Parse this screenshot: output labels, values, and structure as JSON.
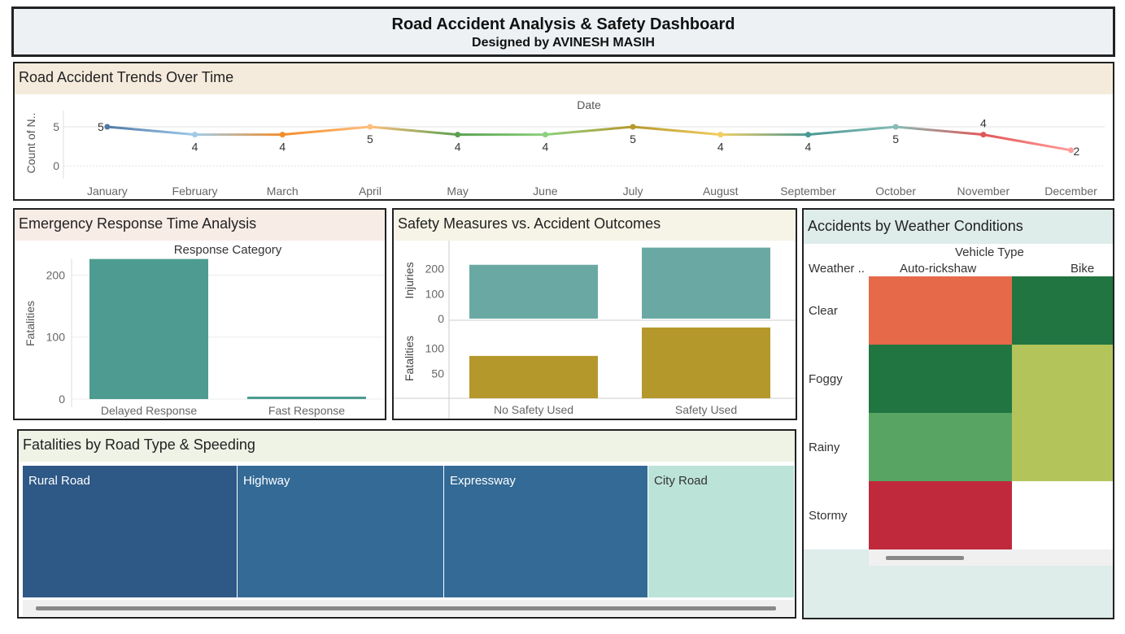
{
  "header": {
    "title": "Road Accident Analysis & Safety Dashboard",
    "subtitle": "Designed by AVINESH MASIH"
  },
  "colors": {
    "teal": "#4e9c91",
    "teal_light": "#6aa9a3",
    "olive": "#b5982c",
    "treemap_dark": "#2e5886",
    "treemap_mid": "#336a96",
    "treemap_light": "#bce3d8",
    "hm_orange": "#e6694a",
    "hm_dark_green": "#217540",
    "hm_mid_green": "#58a563",
    "hm_yellow_green": "#b2c45a",
    "hm_red": "#c0293c"
  },
  "trends": {
    "panel_title": "Road Accident Trends Over Time",
    "chart_data": {
      "type": "line",
      "title": "Date",
      "xlabel": "Date",
      "ylabel": "Count of N..",
      "ylim": [
        0,
        6
      ],
      "y_ticks": [
        0,
        5
      ],
      "categories": [
        "January",
        "February",
        "March",
        "April",
        "May",
        "June",
        "July",
        "August",
        "September",
        "October",
        "November",
        "December"
      ],
      "values": [
        5,
        4,
        4,
        5,
        4,
        4,
        5,
        4,
        4,
        5,
        4,
        2
      ],
      "point_colors": [
        "#4e79a7",
        "#a0cbe8",
        "#f28e2b",
        "#ffbe7d",
        "#59a14f",
        "#8cd17d",
        "#b6992d",
        "#f1ce63",
        "#499894",
        "#86bcb6",
        "#e15759",
        "#ff9d9a"
      ]
    }
  },
  "response": {
    "panel_title": "Emergency Response Time Analysis",
    "chart_data": {
      "type": "bar",
      "title": "Response Category",
      "ylabel": "Fatalities",
      "categories": [
        "Delayed Response",
        "Fast Response"
      ],
      "values": [
        226,
        4
      ],
      "ylim": [
        0,
        236
      ],
      "y_ticks": [
        0,
        100,
        200
      ]
    }
  },
  "safety": {
    "panel_title": "Safety Measures vs. Accident Outcomes",
    "chart_data": {
      "type": "bar",
      "categories": [
        "No Safety Used",
        "Safety Used"
      ],
      "series": [
        {
          "name": "Injuries",
          "values": [
            216,
            285
          ],
          "ylim": [
            0,
            300
          ],
          "y_ticks": [
            0,
            100,
            200
          ]
        },
        {
          "name": "Fatalities",
          "values": [
            85,
            142
          ],
          "ylim": [
            0,
            150
          ],
          "y_ticks": [
            50,
            100
          ]
        }
      ]
    }
  },
  "treemap": {
    "panel_title": "Fatalities by Road Type & Speeding",
    "items": [
      {
        "label": "Rural Road"
      },
      {
        "label": "Highway"
      },
      {
        "label": "Expressway"
      },
      {
        "label": "City Road"
      }
    ]
  },
  "weather": {
    "panel_title": "Accidents by Weather Conditions",
    "chart_data": {
      "type": "heatmap",
      "column_header": "Vehicle Type",
      "row_header": "Weather ..",
      "columns": [
        "Auto-rickshaw",
        "Bike"
      ],
      "rows": [
        "Clear",
        "Foggy",
        "Rainy",
        "Stormy"
      ],
      "cell_colors": [
        [
          "#e6694a",
          "#217540"
        ],
        [
          "#217540",
          "#b2c45a"
        ],
        [
          "#58a563",
          "#b2c45a"
        ],
        [
          "#c0293c",
          "#ffffff"
        ]
      ]
    }
  }
}
